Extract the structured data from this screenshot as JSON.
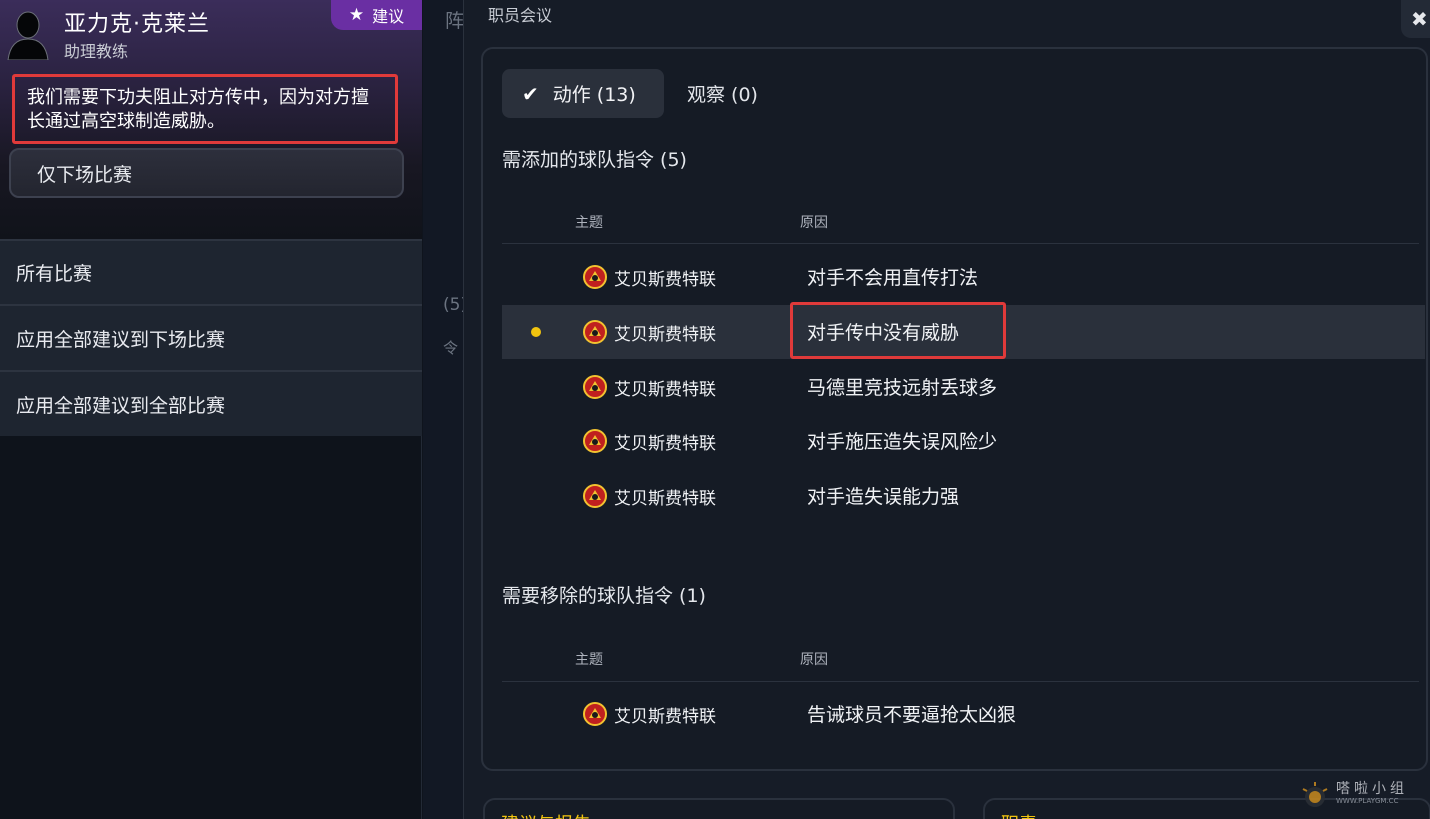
{
  "advisor": {
    "name": "亚力克·克莱兰",
    "role": "助理教练",
    "badge_label": "建议",
    "quote": "我们需要下功夫阻止对方传中，因为对方擅长通过高空球制造威胁。",
    "scope_button": "仅下场比赛"
  },
  "left_menu": [
    {
      "label": "所有比赛"
    },
    {
      "label": "应用全部建议到下场比赛"
    },
    {
      "label": "应用全部建议到全部比赛"
    }
  ],
  "background_page": {
    "partial_1": "阵",
    "partial_2": "(5)",
    "partial_3": "令"
  },
  "modal": {
    "title": "职员会议",
    "close_icon": "✖",
    "tabs": [
      {
        "label": "动作 (13)",
        "active": true
      },
      {
        "label": "观察 (0)",
        "active": false
      }
    ],
    "add_section": {
      "title": "需添加的球队指令 (5)",
      "col_subject": "主题",
      "col_reason": "原因",
      "rows": [
        {
          "team": "艾贝斯费特联",
          "reason": "对手不会用直传打法",
          "selected": false
        },
        {
          "team": "艾贝斯费特联",
          "reason": "对手传中没有威胁",
          "selected": true
        },
        {
          "team": "艾贝斯费特联",
          "reason": "马德里竞技远射丢球多",
          "selected": false
        },
        {
          "team": "艾贝斯费特联",
          "reason": "对手施压造失误风险少",
          "selected": false
        },
        {
          "team": "艾贝斯费特联",
          "reason": "对手造失误能力强",
          "selected": false
        }
      ]
    },
    "remove_section": {
      "title": "需要移除的球队指令 (1)",
      "col_subject": "主题",
      "col_reason": "原因",
      "rows": [
        {
          "team": "艾贝斯费特联",
          "reason": "告诫球员不要逼抢太凶狠"
        }
      ]
    },
    "bottom_left_partial": "建议与报告",
    "bottom_right_partial": "职责"
  },
  "watermark": {
    "main": "嗒啦小组",
    "sub": "WWW.PLAYGM.CC"
  },
  "colors": {
    "badge": "#6a2fa3",
    "highlight_border": "#e03a3a",
    "selected_dot": "#f1c40f",
    "selected_row": "#2a303b"
  }
}
